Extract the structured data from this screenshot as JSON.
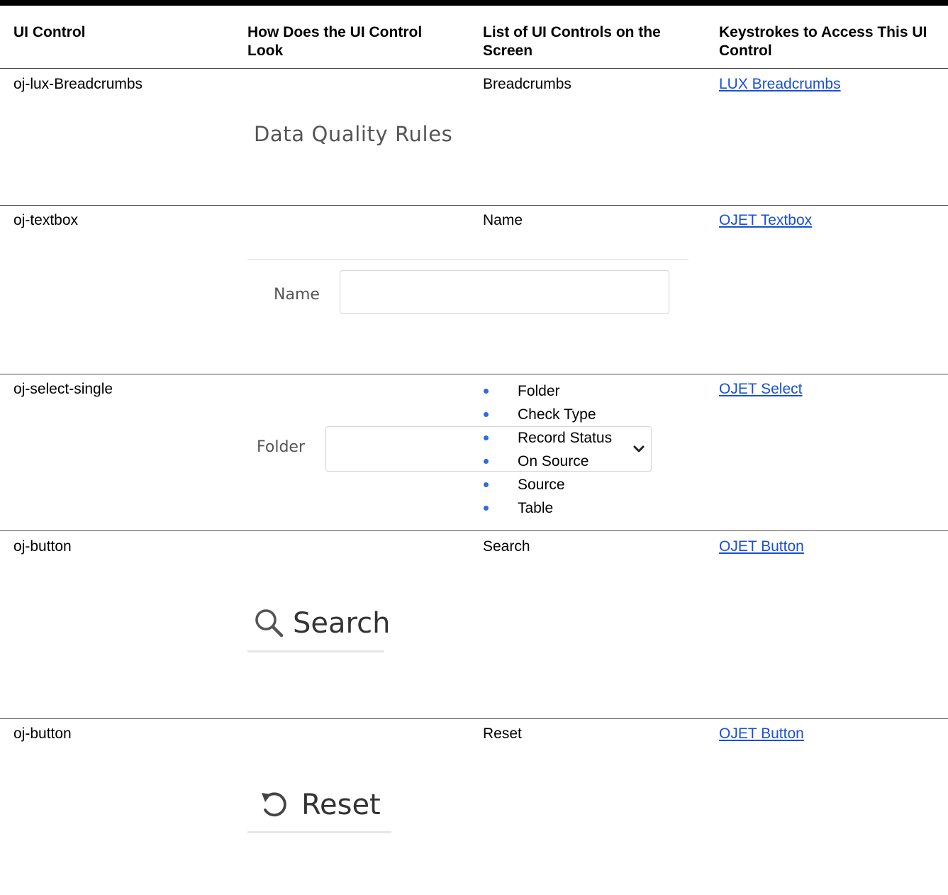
{
  "headers": {
    "col1": "UI Control",
    "col2": "How Does the UI Control Look",
    "col3": "List of UI Controls on the Screen",
    "col4": "Keystrokes to Access This UI Control"
  },
  "rows": [
    {
      "control": "oj-lux-Breadcrumbs",
      "look_text": "Data Quality Rules",
      "list": "Breadcrumbs",
      "link": "LUX Breadcrumbs"
    },
    {
      "control": "oj-textbox",
      "look_label": "Name",
      "list": "Name",
      "link": "OJET Textbox"
    },
    {
      "control": "oj-select-single",
      "look_label": "Folder",
      "list_items": [
        "Folder",
        "Check Type",
        "Record Status",
        "On Source",
        "Source",
        "Table"
      ],
      "link": "OJET Select"
    },
    {
      "control": "oj-button",
      "look_label": "Search",
      "look_icon": "search-icon",
      "list": "Search",
      "link": "OJET Button"
    },
    {
      "control": "oj-button",
      "look_label": "Reset",
      "look_icon": "reset-icon",
      "list": "Reset",
      "link": "OJET Button"
    }
  ],
  "colors": {
    "link": "#1a4fd6",
    "bullet": "#2f6cd8",
    "image_text": "#555555"
  }
}
